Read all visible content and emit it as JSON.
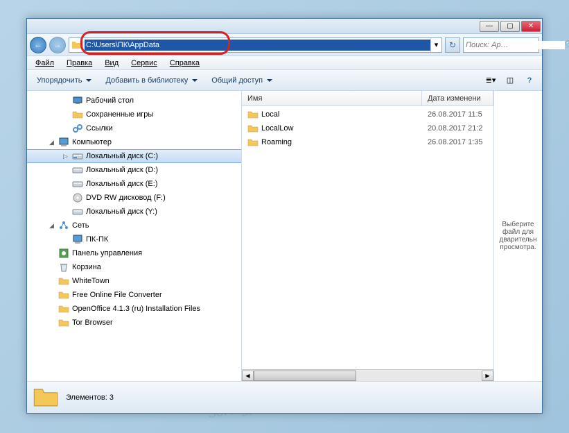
{
  "titlebar": {
    "min": "—",
    "max": "▢",
    "close": "✕"
  },
  "nav": {
    "back": "←",
    "fwd": "→",
    "address": "C:\\Users\\ПК\\AppData",
    "refresh": "↻",
    "search_placeholder": "Поиск: Ap…",
    "search_icon": "🔍"
  },
  "menu": {
    "file": "Файл",
    "edit": "Правка",
    "view": "Вид",
    "tools": "Сервис",
    "help": "Справка"
  },
  "toolbar": {
    "organize": "Упорядочить",
    "addlib": "Добавить в библиотеку",
    "share": "Общий доступ"
  },
  "tree": [
    {
      "indent": 50,
      "icon": "desktop",
      "label": "Рабочий стол"
    },
    {
      "indent": 50,
      "icon": "folder-save",
      "label": "Сохраненные игры"
    },
    {
      "indent": 50,
      "icon": "link",
      "label": "Ссылки"
    },
    {
      "indent": 30,
      "icon": "computer",
      "label": "Компьютер",
      "exp": "◢"
    },
    {
      "indent": 50,
      "icon": "disk-c",
      "label": "Локальный диск (C:)",
      "sel": true,
      "exp": "▷"
    },
    {
      "indent": 50,
      "icon": "disk",
      "label": "Локальный диск (D:)"
    },
    {
      "indent": 50,
      "icon": "disk",
      "label": "Локальный диск (E:)"
    },
    {
      "indent": 50,
      "icon": "dvd",
      "label": "DVD RW дисковод (F:)"
    },
    {
      "indent": 50,
      "icon": "disk",
      "label": "Локальный диск (Y:)"
    },
    {
      "indent": 30,
      "icon": "network",
      "label": "Сеть",
      "exp": "◢"
    },
    {
      "indent": 50,
      "icon": "pc",
      "label": "ПК-ПК"
    },
    {
      "indent": 30,
      "icon": "cpanel",
      "label": "Панель управления"
    },
    {
      "indent": 30,
      "icon": "bin",
      "label": "Корзина"
    },
    {
      "indent": 30,
      "icon": "folder",
      "label": "WhiteTown"
    },
    {
      "indent": 30,
      "icon": "folder",
      "label": "Free Online File Converter"
    },
    {
      "indent": 30,
      "icon": "folder",
      "label": "OpenOffice 4.1.3 (ru) Installation Files"
    },
    {
      "indent": 30,
      "icon": "folder",
      "label": "Tor Browser"
    }
  ],
  "columns": {
    "name": "Имя",
    "date": "Дата изменени"
  },
  "files": [
    {
      "name": "Local",
      "date": "26.08.2017 11:5"
    },
    {
      "name": "LocalLow",
      "date": "20.08.2017 21:2"
    },
    {
      "name": "Roaming",
      "date": "26.08.2017 1:35"
    }
  ],
  "preview": "Выберите файл для дварительн просмотра.",
  "status": {
    "label": "Элементов:",
    "count": "3"
  },
  "watermark": "Soringpcrepair.com"
}
